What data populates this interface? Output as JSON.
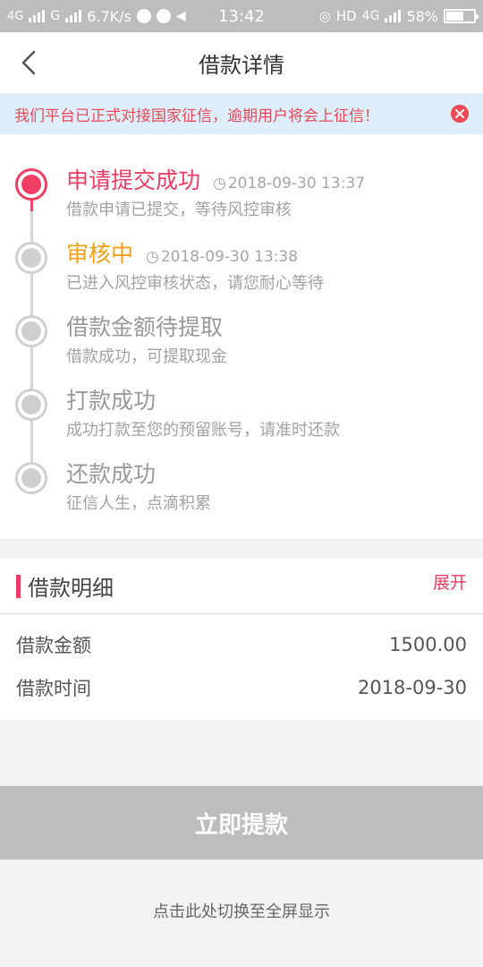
{
  "status_bar": {
    "network_1": "4G",
    "network_2": "G",
    "speed": "6.7K/s",
    "time": "13:42",
    "hd": "HD",
    "network_3": "4G",
    "battery": "58%"
  },
  "header": {
    "title": "借款详情"
  },
  "notice": {
    "text": "我们平台已正式对接国家征信，逾期用户将会上征信！"
  },
  "steps": [
    {
      "title": "申请提交成功",
      "time": "2018-09-30 13:37",
      "desc": "借款申请已提交，等待风控审核"
    },
    {
      "title": "审核中",
      "time": "2018-09-30 13:38",
      "desc": "已进入风控审核状态，请您耐心等待"
    },
    {
      "title": "借款金额待提取",
      "time": "",
      "desc": "借款成功，可提取现金"
    },
    {
      "title": "打款成功",
      "time": "",
      "desc": "成功打款至您的预留账号，请准时还款"
    },
    {
      "title": "还款成功",
      "time": "",
      "desc": "征信人生，点滴积累"
    }
  ],
  "detail": {
    "title": "借款明细",
    "expand_label": "展开",
    "rows": [
      {
        "label": "借款金额",
        "value": "1500.00"
      },
      {
        "label": "借款时间",
        "value": "2018-09-30"
      }
    ]
  },
  "withdraw_button": "立即提款",
  "fullscreen_tip": "点击此处切换至全屏显示",
  "colors": {
    "accent": "#ec3d62",
    "pending": "#f2a014",
    "inactive": "#cfcfcf"
  }
}
